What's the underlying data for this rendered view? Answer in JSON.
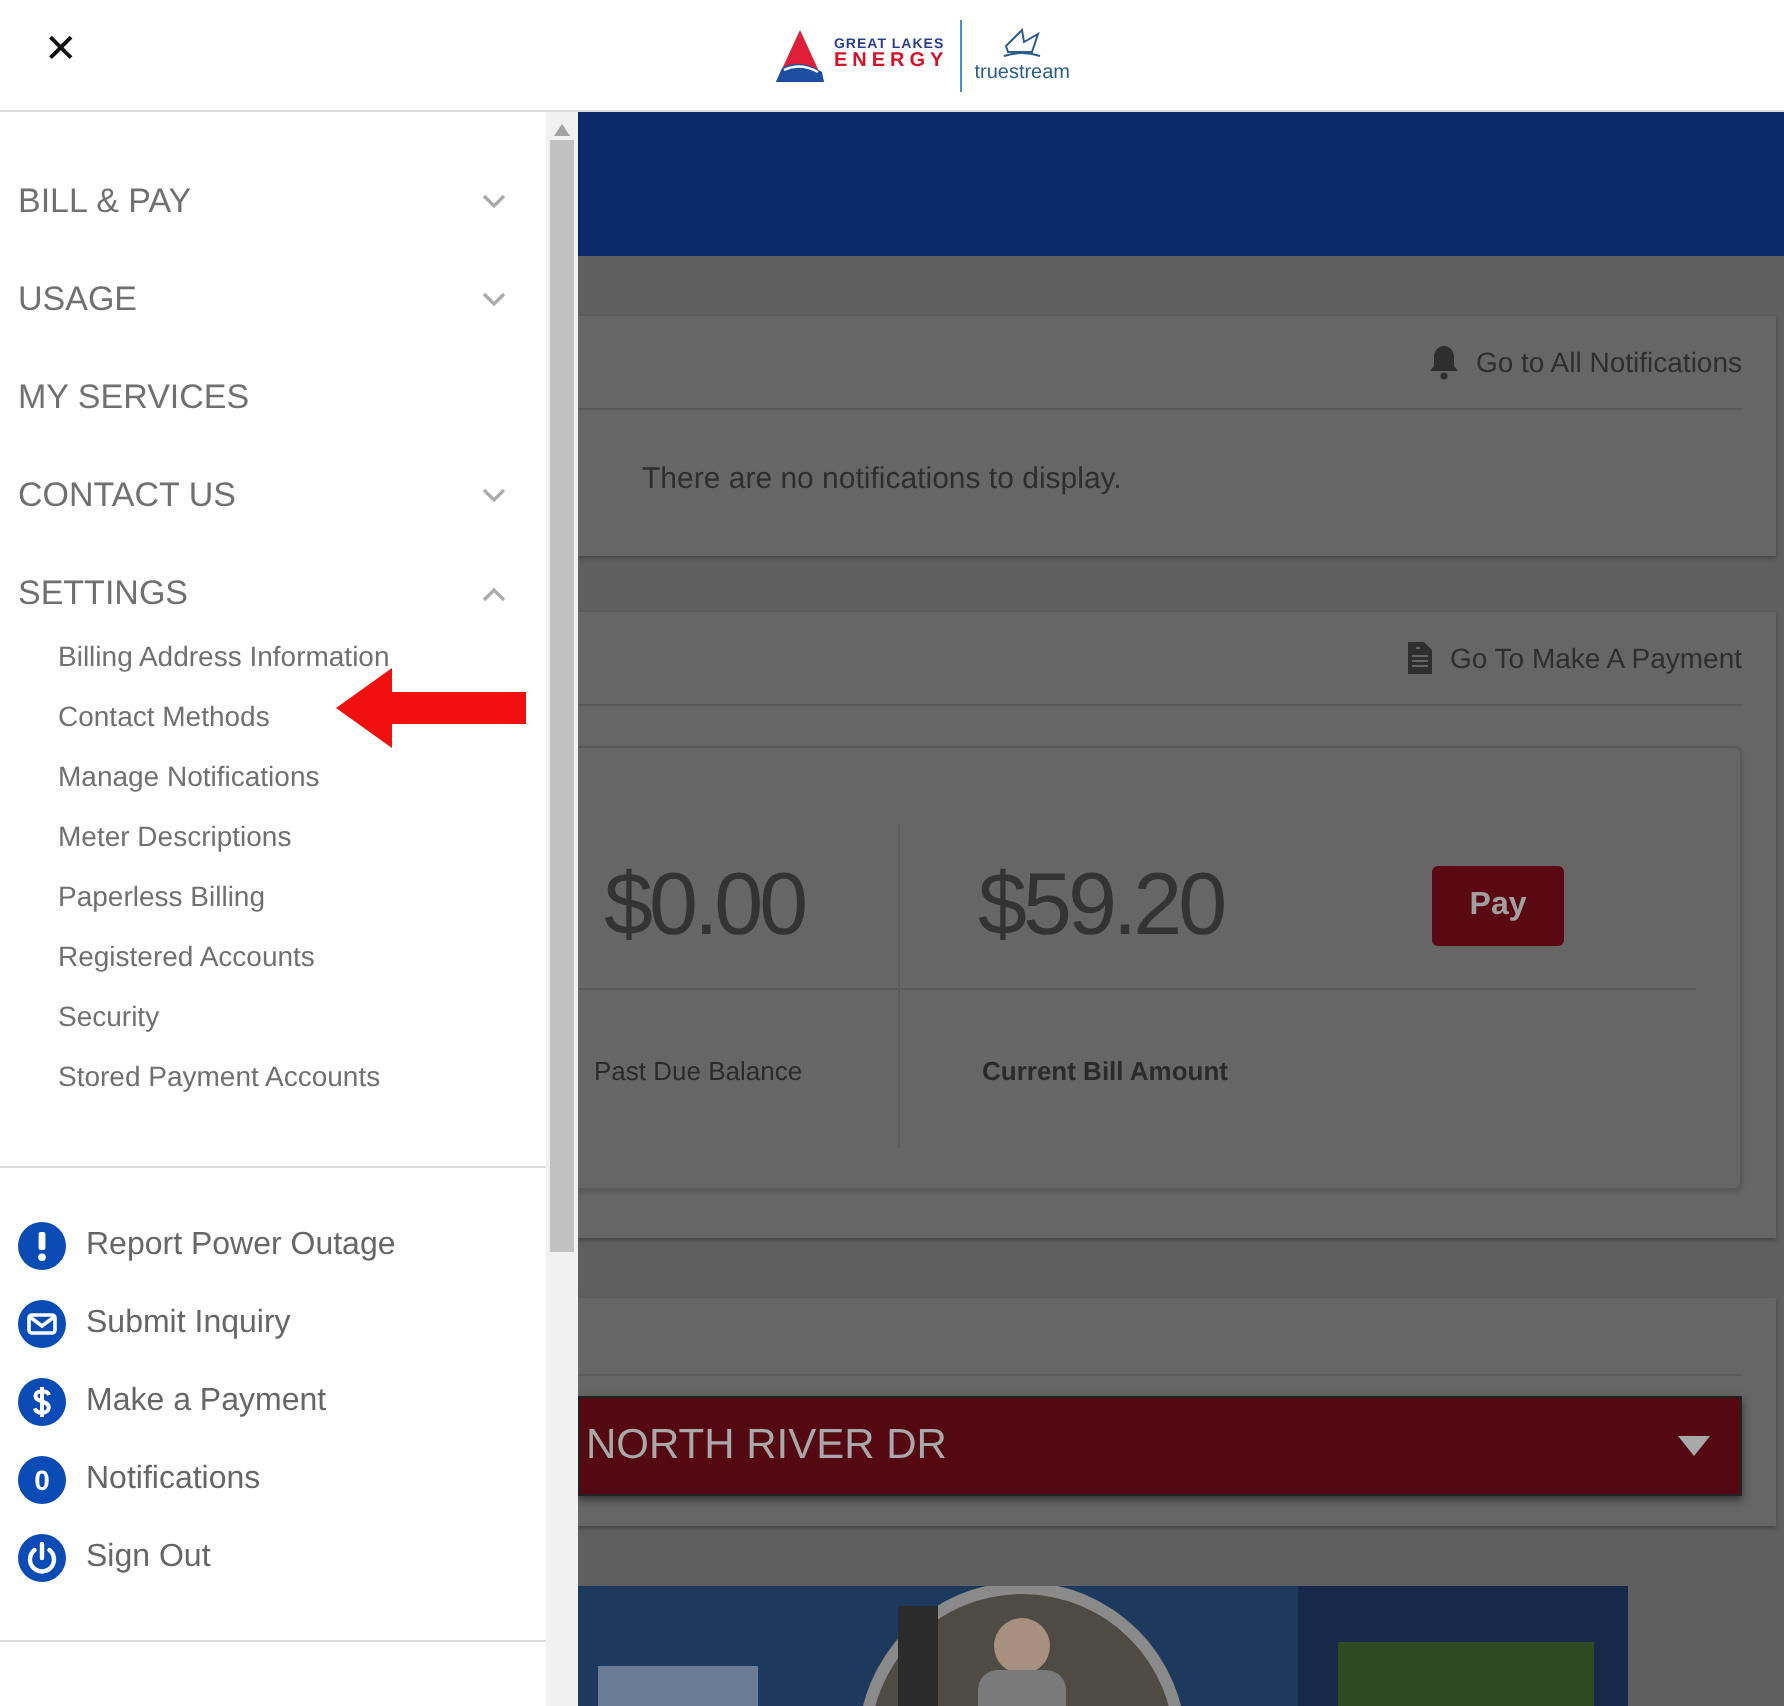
{
  "header": {
    "close": "✕",
    "logo": {
      "line1": "GREAT LAKES",
      "line2": "ENERGY",
      "partner": "truestream"
    }
  },
  "menu": {
    "sections": [
      {
        "kind": "group",
        "label": "BILL & PAY",
        "expanded": false
      },
      {
        "kind": "group",
        "label": "USAGE",
        "expanded": false
      },
      {
        "kind": "link",
        "label": "MY SERVICES"
      },
      {
        "kind": "group",
        "label": "CONTACT US",
        "expanded": false
      },
      {
        "kind": "group",
        "label": "SETTINGS",
        "expanded": true,
        "children": [
          "Billing Address Information",
          "Contact Methods",
          "Manage Notifications",
          "Meter Descriptions",
          "Paperless Billing",
          "Registered Accounts",
          "Security",
          "Stored Payment Accounts"
        ]
      }
    ],
    "actions": [
      {
        "kind": "alert",
        "label": "Report Power Outage"
      },
      {
        "kind": "mail",
        "label": "Submit Inquiry"
      },
      {
        "kind": "dollar",
        "label": "Make a Payment"
      },
      {
        "kind": "count",
        "badge": "0",
        "label": "Notifications"
      },
      {
        "kind": "power",
        "label": "Sign Out"
      }
    ]
  },
  "notifications": {
    "link": "Go to All Notifications",
    "message": "There are no notifications to display."
  },
  "payment": {
    "link": "Go To Make A Payment",
    "past_due": {
      "amount": "$0.00",
      "label": "Past Due Balance"
    },
    "current": {
      "amount": "$59.20",
      "label": "Current Bill Amount"
    },
    "button": "Pay"
  },
  "account": {
    "address": "NORTH RIVER DR"
  }
}
